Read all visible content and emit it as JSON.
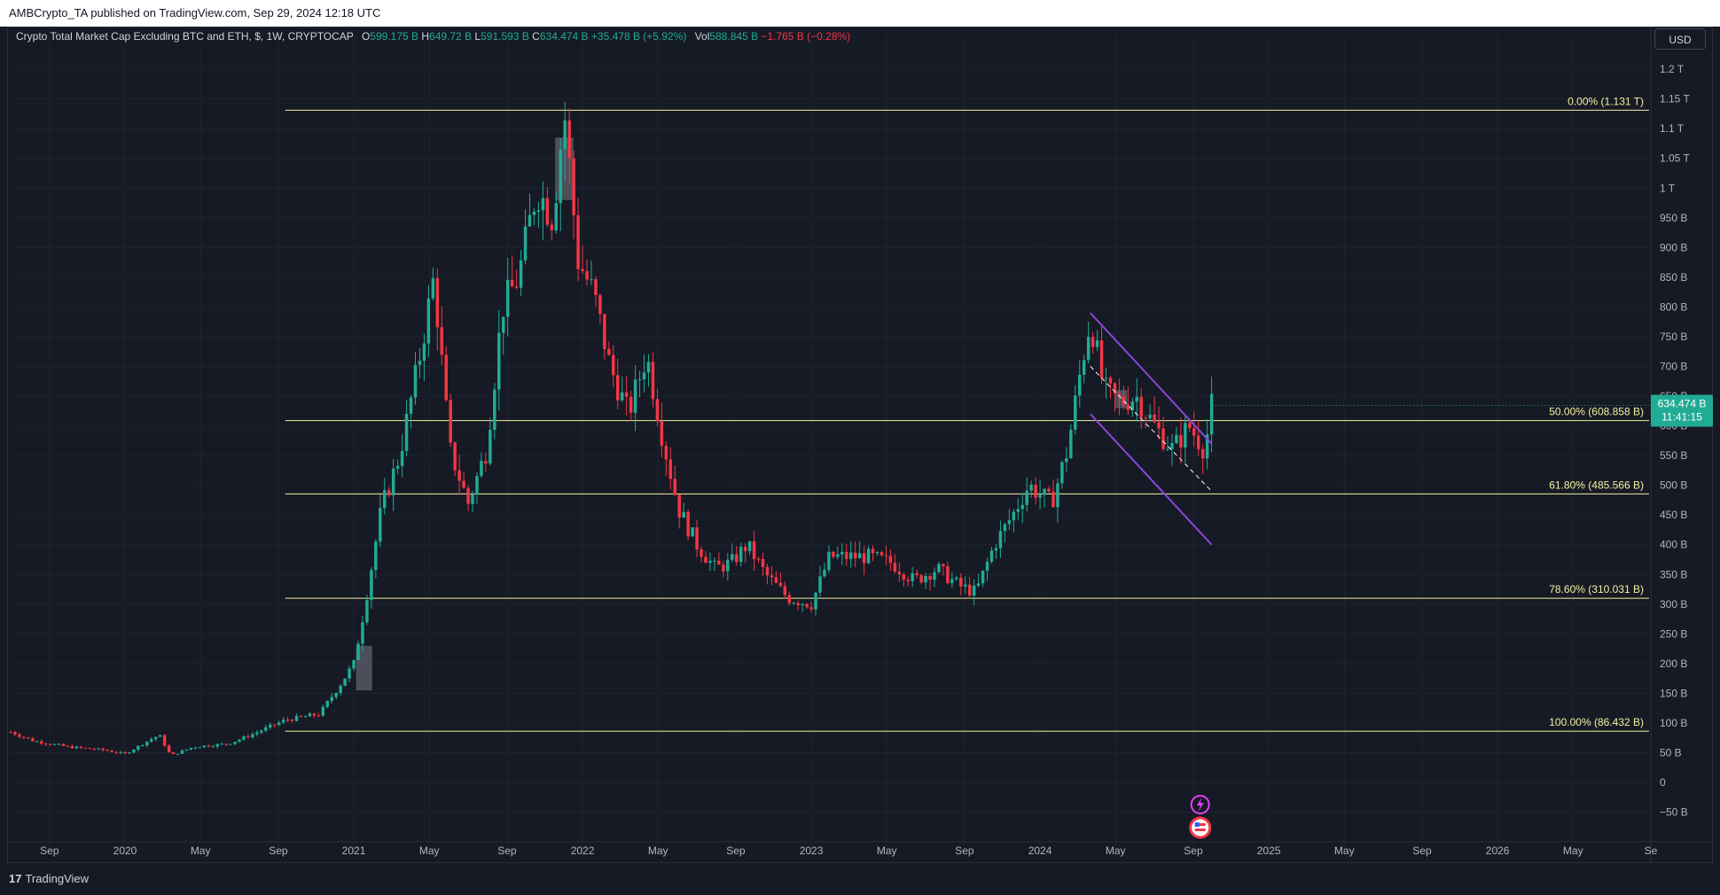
{
  "header": {
    "published": "AMBCrypto_TA published on TradingView.com, Sep 29, 2024 12:18 UTC"
  },
  "legend": {
    "symbol": "Crypto Total Market Cap Excluding BTC and ETH, $, 1W, CRYPTOCAP",
    "open_label": "O",
    "open": "599.175 B",
    "high_label": "H",
    "high": "649.72 B",
    "low_label": "L",
    "low": "591.593 B",
    "close_label": "C",
    "close": "634.474 B",
    "change": "+35.478 B (+5.92%)",
    "vol_label": "Vol",
    "vol": "588.845 B",
    "vol_change": "−1.765 B (−0.28%)"
  },
  "currency_button": "USD",
  "price_badge": {
    "value": "634.474 B",
    "countdown": "11:41:15"
  },
  "branding": {
    "logo_text": "TradingView",
    "logo_mark": "17"
  },
  "colors": {
    "background": "#161a25",
    "up": "#22ab94",
    "down": "#f23645",
    "fib": "#f5f0a0",
    "channel": "#8b45d9",
    "grid": "#1f2330"
  },
  "icons": [
    "lightning-icon",
    "us-flag-icon"
  ],
  "chart_data": {
    "type": "candlestick",
    "title": "Crypto Total Market Cap Excluding BTC and ETH, $, 1W, CRYPTOCAP",
    "y_axis_ticks": [
      "1.2 T",
      "1.15 T",
      "1.1 T",
      "1.05 T",
      "1 T",
      "950 B",
      "900 B",
      "850 B",
      "800 B",
      "750 B",
      "700 B",
      "650 B",
      "600 B",
      "550 B",
      "500 B",
      "450 B",
      "400 B",
      "350 B",
      "300 B",
      "250 B",
      "200 B",
      "150 B",
      "100 B",
      "50 B",
      "0",
      "−50 B"
    ],
    "y_axis_values": [
      1200,
      1150,
      1100,
      1050,
      1000,
      950,
      900,
      850,
      800,
      750,
      700,
      650,
      600,
      550,
      500,
      450,
      400,
      350,
      300,
      250,
      200,
      150,
      100,
      50,
      0,
      -50
    ],
    "ylim": [
      -70,
      1230
    ],
    "x_axis_ticks": [
      "Sep",
      "2020",
      "May",
      "Sep",
      "2021",
      "May",
      "Sep",
      "2022",
      "May",
      "Sep",
      "2023",
      "May",
      "Sep",
      "2024",
      "May",
      "Sep",
      "2025",
      "May",
      "Sep",
      "2026",
      "May",
      "Se"
    ],
    "x_axis_values": [
      2019.67,
      2020.0,
      2020.33,
      2020.67,
      2021.0,
      2021.33,
      2021.67,
      2022.0,
      2022.33,
      2022.67,
      2023.0,
      2023.33,
      2023.67,
      2024.0,
      2024.33,
      2024.67,
      2025.0,
      2025.33,
      2025.67,
      2026.0,
      2026.33,
      2026.67
    ],
    "xlim": [
      2019.5,
      2026.67
    ],
    "unit": "billion USD",
    "fib_levels": [
      {
        "label": "0.00% (1.131 T)",
        "value": 1131
      },
      {
        "label": "50.00% (608.858 B)",
        "value": 608.858
      },
      {
        "label": "61.80% (485.566 B)",
        "value": 485.566
      },
      {
        "label": "78.60% (310.031 B)",
        "value": 310.031
      },
      {
        "label": "100.00% (86.432 B)",
        "value": 86.432
      }
    ],
    "fib_x_start": 2020.7,
    "fib_x_end": 2026.67,
    "price_path": [
      [
        2019.5,
        85
      ],
      [
        2019.6,
        70
      ],
      [
        2019.75,
        60
      ],
      [
        2019.9,
        55
      ],
      [
        2020.0,
        48
      ],
      [
        2020.1,
        70
      ],
      [
        2020.15,
        80
      ],
      [
        2020.2,
        45
      ],
      [
        2020.3,
        60
      ],
      [
        2020.45,
        65
      ],
      [
        2020.55,
        80
      ],
      [
        2020.7,
        105
      ],
      [
        2020.85,
        115
      ],
      [
        2020.95,
        170
      ],
      [
        2021.0,
        200
      ],
      [
        2021.05,
        300
      ],
      [
        2021.12,
        460
      ],
      [
        2021.2,
        550
      ],
      [
        2021.28,
        700
      ],
      [
        2021.35,
        850
      ],
      [
        2021.42,
        560
      ],
      [
        2021.5,
        470
      ],
      [
        2021.58,
        560
      ],
      [
        2021.65,
        800
      ],
      [
        2021.72,
        850
      ],
      [
        2021.8,
        1000
      ],
      [
        2021.87,
        950
      ],
      [
        2021.92,
        1130
      ],
      [
        2021.98,
        880
      ],
      [
        2022.05,
        820
      ],
      [
        2022.12,
        700
      ],
      [
        2022.2,
        620
      ],
      [
        2022.28,
        720
      ],
      [
        2022.35,
        580
      ],
      [
        2022.42,
        460
      ],
      [
        2022.5,
        400
      ],
      [
        2022.58,
        360
      ],
      [
        2022.65,
        370
      ],
      [
        2022.72,
        400
      ],
      [
        2022.8,
        350
      ],
      [
        2022.9,
        310
      ],
      [
        2023.0,
        300
      ],
      [
        2023.08,
        380
      ],
      [
        2023.15,
        380
      ],
      [
        2023.25,
        380
      ],
      [
        2023.35,
        370
      ],
      [
        2023.45,
        340
      ],
      [
        2023.55,
        360
      ],
      [
        2023.65,
        330
      ],
      [
        2023.72,
        320
      ],
      [
        2023.8,
        400
      ],
      [
        2023.88,
        450
      ],
      [
        2023.95,
        500
      ],
      [
        2024.05,
        470
      ],
      [
        2024.12,
        560
      ],
      [
        2024.18,
        700
      ],
      [
        2024.22,
        780
      ],
      [
        2024.28,
        660
      ],
      [
        2024.35,
        640
      ],
      [
        2024.42,
        650
      ],
      [
        2024.5,
        600
      ],
      [
        2024.58,
        560
      ],
      [
        2024.65,
        600
      ],
      [
        2024.72,
        560
      ],
      [
        2024.75,
        634
      ]
    ],
    "channel": {
      "upper": [
        [
          2024.22,
          790
        ],
        [
          2024.75,
          570
        ]
      ],
      "lower": [
        [
          2024.22,
          620
        ],
        [
          2024.75,
          400
        ]
      ],
      "mid_dashed": [
        [
          2024.22,
          700
        ],
        [
          2024.75,
          490
        ]
      ]
    },
    "highlight_boxes": [
      {
        "x0": 2021.01,
        "x1": 2021.08,
        "y0": 155,
        "y1": 230
      },
      {
        "x0": 2021.88,
        "x1": 2021.96,
        "y0": 980,
        "y1": 1085
      },
      {
        "x0": 2024.33,
        "x1": 2024.38,
        "y0": 630,
        "y1": 660
      }
    ],
    "last_price": 634.474,
    "grid": true
  }
}
